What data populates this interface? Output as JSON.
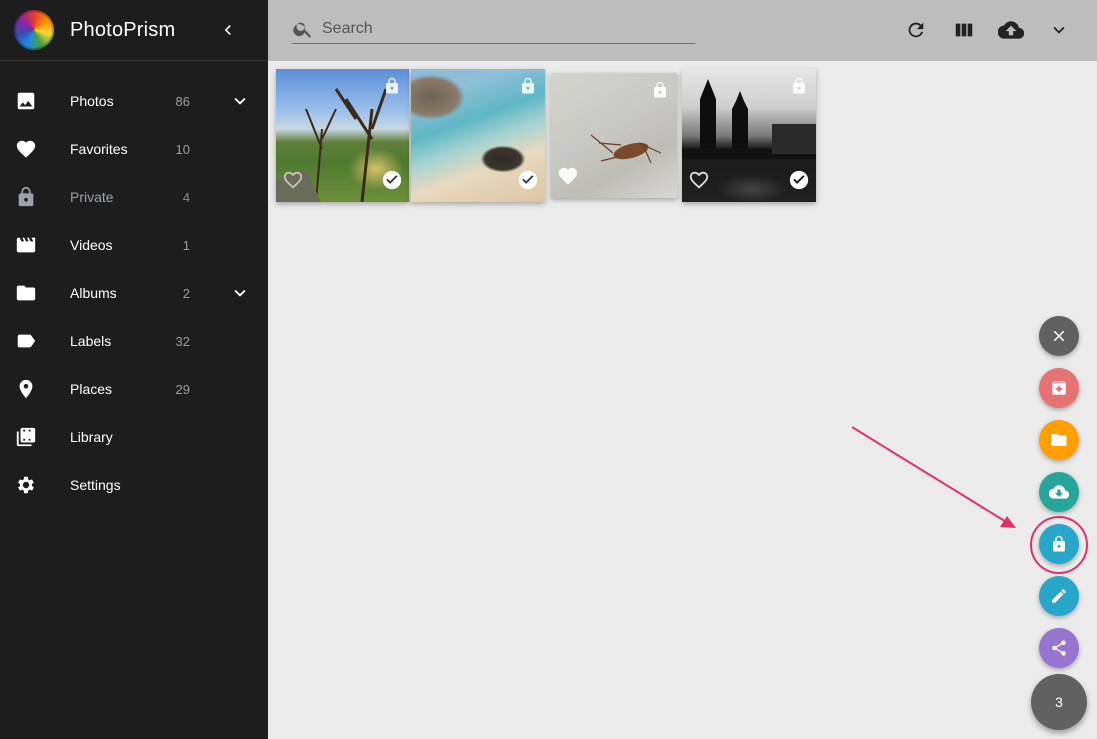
{
  "app": {
    "title": "PhotoPrism"
  },
  "search": {
    "placeholder": "Search"
  },
  "sidebar": {
    "items": [
      {
        "label": "Photos",
        "count": "86"
      },
      {
        "label": "Favorites",
        "count": "10"
      },
      {
        "label": "Private",
        "count": "4"
      },
      {
        "label": "Videos",
        "count": "1"
      },
      {
        "label": "Albums",
        "count": "2"
      },
      {
        "label": "Labels",
        "count": "32"
      },
      {
        "label": "Places",
        "count": "29"
      },
      {
        "label": "Library",
        "count": ""
      },
      {
        "label": "Settings",
        "count": ""
      }
    ]
  },
  "toolbar": {
    "icons": [
      "refresh-icon",
      "view-column-icon",
      "cloud-upload-icon",
      "chevron-down-icon"
    ]
  },
  "photos": [
    {
      "description": "garden with trees",
      "private": true,
      "favorite": false,
      "selected": true
    },
    {
      "description": "beach with rocks",
      "private": true,
      "favorite": false,
      "selected": true
    },
    {
      "description": "cockroach on floor",
      "private": true,
      "favorite": false,
      "selected": false
    },
    {
      "description": "black and white bridge towers",
      "private": true,
      "favorite": false,
      "selected": true
    }
  ],
  "fab": {
    "selection_count": "3",
    "actions": [
      {
        "name": "close",
        "color": "#616161"
      },
      {
        "name": "archive",
        "color": "#e57373"
      },
      {
        "name": "add-to-album",
        "color": "#ffa000"
      },
      {
        "name": "download",
        "color": "#26a69a"
      },
      {
        "name": "private",
        "color": "#26a6c9"
      },
      {
        "name": "edit",
        "color": "#26a6c9"
      },
      {
        "name": "share",
        "color": "#9575cd"
      }
    ]
  },
  "colors": {
    "sidebar_bg": "#1d1d1d",
    "toolbar_bg": "#bdbdbd",
    "content_bg": "#ebebeb",
    "highlight": "#e0306a"
  }
}
